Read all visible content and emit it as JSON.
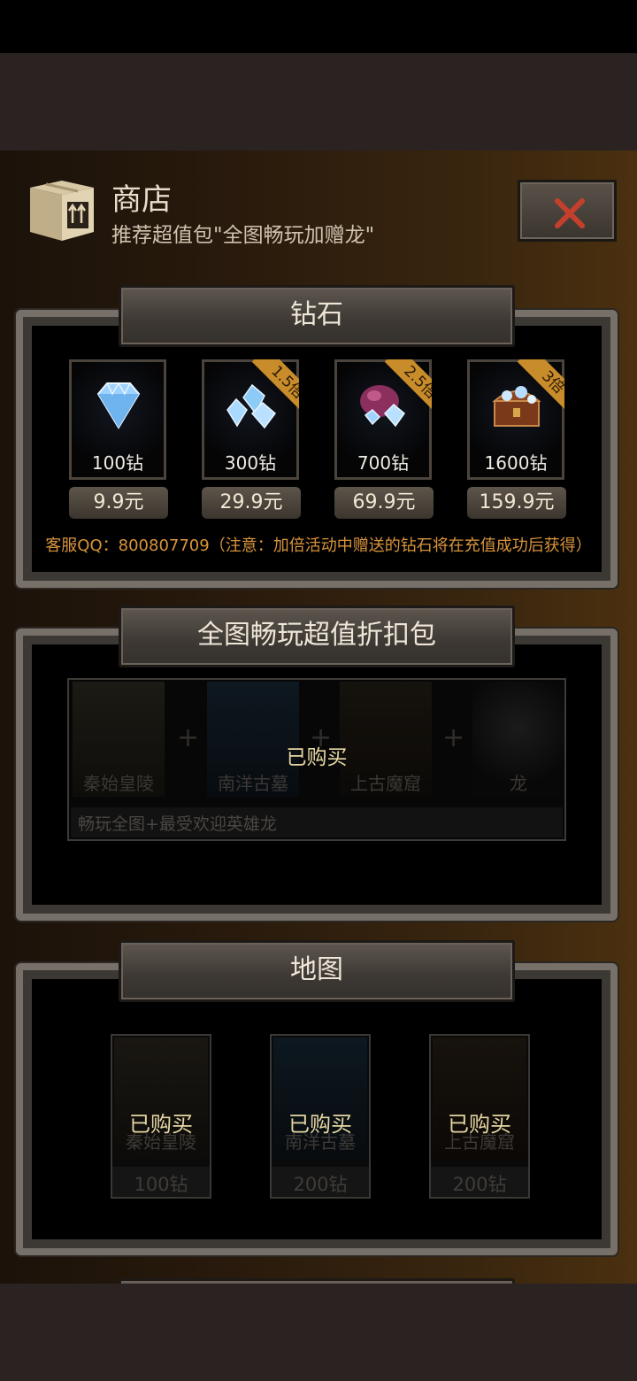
{
  "shop": {
    "title": "商店",
    "subtitle": "推荐超值包\"全图畅玩加赠龙\"",
    "icons": {
      "shop": "cardboard-box-icon",
      "close": "close-x-icon"
    },
    "colors": {
      "accent": "#d9943b",
      "close_x": "#c4402c",
      "bought": "#e6d6a3"
    }
  },
  "diamonds": {
    "title": "钻石",
    "items": [
      {
        "amount": "100钻",
        "price": "9.9元",
        "bonus": "",
        "icon": "diamond-icon"
      },
      {
        "amount": "300钻",
        "price": "29.9元",
        "bonus": "1.5倍",
        "icon": "diamond-pile-icon"
      },
      {
        "amount": "700钻",
        "price": "69.9元",
        "bonus": "2.5倍",
        "icon": "diamond-bag-icon"
      },
      {
        "amount": "1600钻",
        "price": "159.9元",
        "bonus": "3倍",
        "icon": "treasure-chest-icon"
      }
    ],
    "notice": "客服QQ：800807709（注意：加倍活动中赠送的钻石将在充值成功后获得）"
  },
  "bundle": {
    "title": "全图畅玩超值折扣包",
    "items": [
      "秦始皇陵",
      "南洋古墓",
      "上古魔窟",
      "龙"
    ],
    "status": "已购买",
    "description": "畅玩全图+最受欢迎英雄龙"
  },
  "maps": {
    "title": "地图",
    "items": [
      {
        "name": "秦始皇陵",
        "price": "100钻",
        "status": "已购买"
      },
      {
        "name": "南洋古墓",
        "price": "200钻",
        "status": "已购买"
      },
      {
        "name": "上古魔窟",
        "price": "200钻",
        "status": "已购买"
      }
    ]
  }
}
